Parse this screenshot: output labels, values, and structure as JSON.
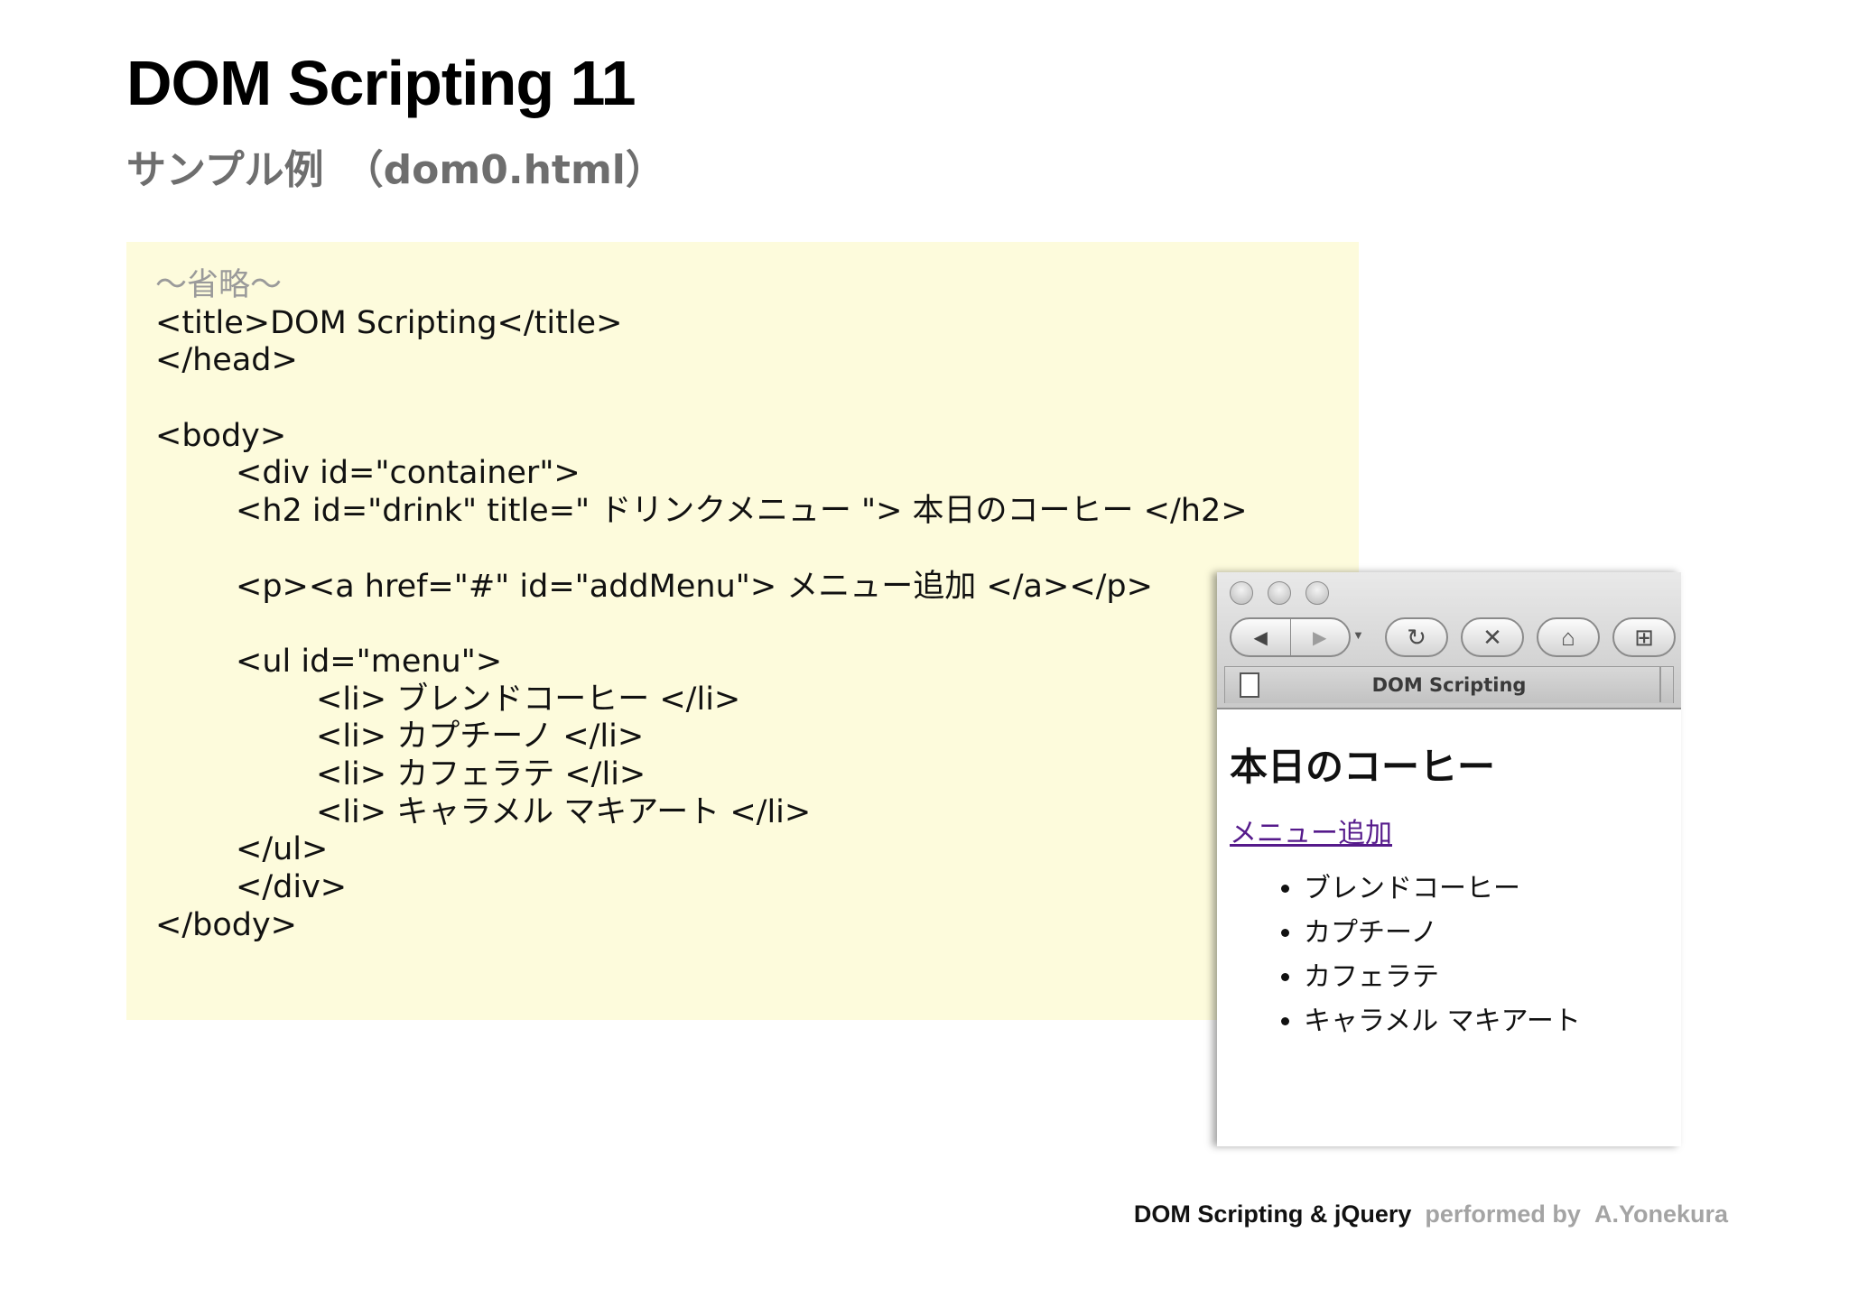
{
  "slide": {
    "title": "DOM Scripting 11",
    "subtitle": "サンプル例　（dom0.html）"
  },
  "code": {
    "lines": [
      "～省略～",
      "<title>DOM Scripting</title>",
      "</head>",
      "",
      "<body>",
      "        <div id=\"container\">",
      "        <h2 id=\"drink\" title=\" ドリンクメニュー \"> 本日のコーヒー </h2>",
      "",
      "        <p><a href=\"#\" id=\"addMenu\"> メニュー追加 </a></p>",
      "",
      "        <ul id=\"menu\">",
      "                <li> ブレンドコーヒー </li>",
      "                <li> カプチーノ </li>",
      "                <li> カフェラテ </li>",
      "                <li> キャラメル マキアート </li>",
      "        </ul>",
      "        </div>",
      "</body>"
    ]
  },
  "browser": {
    "tab_title": "DOM Scripting",
    "icons": {
      "back": "back-arrow-icon",
      "forward": "forward-arrow-icon",
      "reload": "reload-icon",
      "stop": "stop-icon",
      "home": "home-icon",
      "bookmark": "add-bookmark-icon",
      "page": "document-icon"
    },
    "page": {
      "heading": "本日のコーヒー",
      "link": "メニュー追加",
      "items": [
        "ブレンドコーヒー",
        "カプチーノ",
        "カフェラテ",
        "キャラメル マキアート"
      ]
    }
  },
  "footer": {
    "brand": "DOM Scripting & jQuery",
    "performed_by": "performed by",
    "author": "A.Yonekura"
  },
  "colors": {
    "code_background": "#fdfbdc",
    "subtitle": "#6e6e6e",
    "link": "#551a8b"
  }
}
